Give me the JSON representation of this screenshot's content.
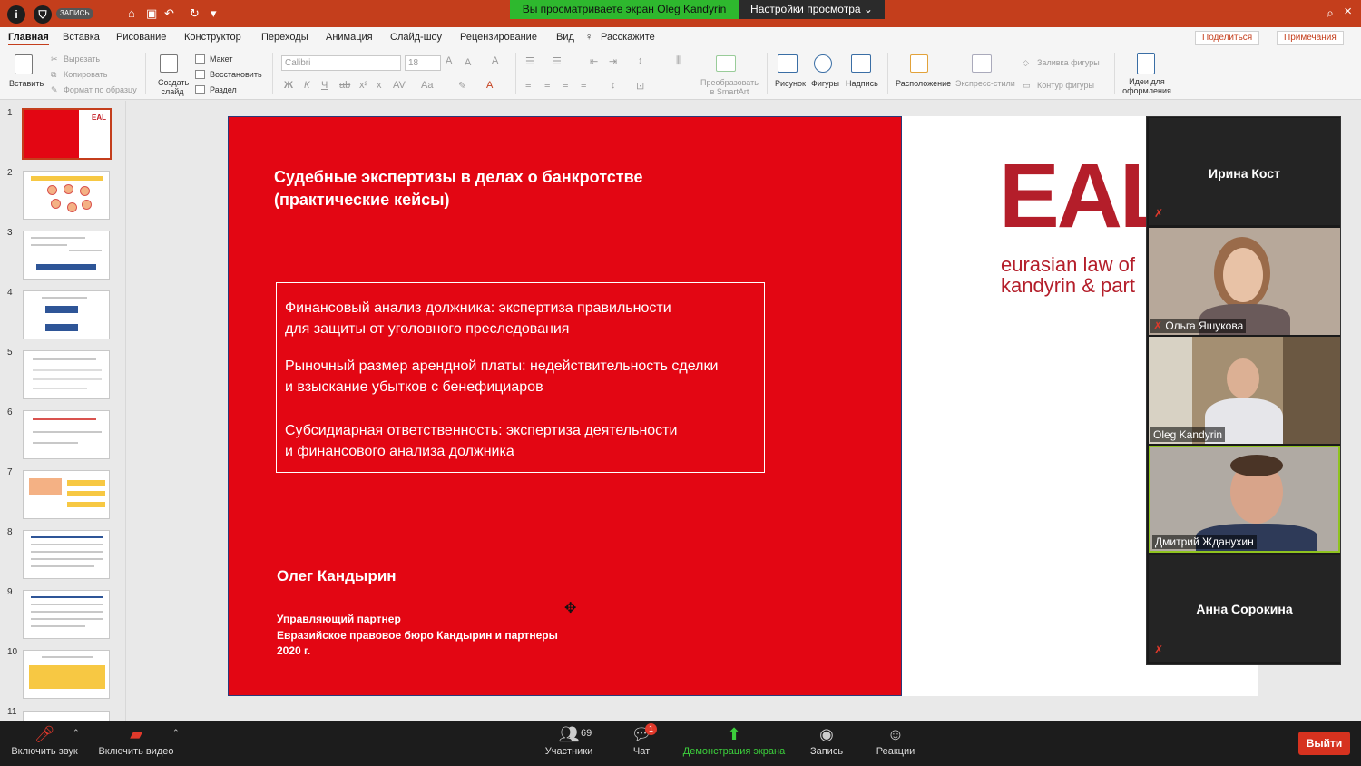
{
  "titlebar": {
    "info_icon": "info-icon",
    "shield_icon": "shield-icon",
    "rec_badge": "ЗАПИСЬ",
    "share_banner": "Вы просматриваете экран Oleg Kandyrin",
    "view_options": "Настройки просмотра"
  },
  "menu": {
    "items": [
      "Главная",
      "Вставка",
      "Рисование",
      "Конструктор",
      "Переходы",
      "Анимация",
      "Слайд-шоу",
      "Рецензирование",
      "Вид",
      "Расскажите"
    ],
    "share_button": "Поделиться",
    "comments_button": "Примечания"
  },
  "ribbon": {
    "paste": "Вставить",
    "cut": "Вырезать",
    "copy": "Копировать",
    "format_painter": "Формат по образцу",
    "new_slide": "Создать слайд",
    "layout": "Макет",
    "reset": "Восстановить",
    "section": "Раздел",
    "font_name": "Calibri",
    "font_size": "18",
    "convert_smartart": "Преобразовать в SmartArt",
    "picture": "Рисунок",
    "shapes": "Фигуры",
    "textbox": "Надпись",
    "arrange": "Расположение",
    "quick_styles": "Экспресс-стили",
    "shape_fill": "Заливка фигуры",
    "shape_outline": "Контур фигуры",
    "design_ideas": "Идеи для оформления"
  },
  "thumbnails": [
    "1",
    "2",
    "3",
    "4",
    "5",
    "6",
    "7",
    "8",
    "9",
    "10",
    "11"
  ],
  "slide": {
    "title_line1": "Судебные экспертизы в делах о банкротстве",
    "title_line2": "(практические кейсы)",
    "item1_line1": "Финансовый анализ должника: экспертиза правильности",
    "item1_line2": "для защиты от уголовного преследования",
    "item2_line1": "Рыночный размер арендной платы: недействительность сделки",
    "item2_line2": "и взыскание убытков с бенефициаров",
    "item3_line1": "Субсидиарная ответственность: экспертиза деятельности",
    "item3_line2": "и финансового анализа должника",
    "author": "Олег Кандырин",
    "position": "Управляющий партнер",
    "company": "Евразийское правовое бюро Кандырин и партнеры",
    "year": "2020 г.",
    "logo_mark": "EAL",
    "logo_line1": "eurasian law of",
    "logo_line2": "kandyrin & part"
  },
  "participants": [
    {
      "name": "Ирина Кост",
      "video": false
    },
    {
      "name": "Ольга Яшукова",
      "video": true
    },
    {
      "name": "Oleg Kandyrin",
      "video": true
    },
    {
      "name": "Дмитрий Жданухин",
      "video": true
    },
    {
      "name": "Анна Сорокина",
      "video": false
    }
  ],
  "toolbar": {
    "audio": "Включить звук",
    "video": "Включить видео",
    "participants": "Участники",
    "participants_count": "69",
    "chat": "Чат",
    "chat_badge": "1",
    "share_screen": "Демонстрация экрана",
    "record": "Запись",
    "reactions": "Реакции",
    "leave": "Выйти"
  }
}
